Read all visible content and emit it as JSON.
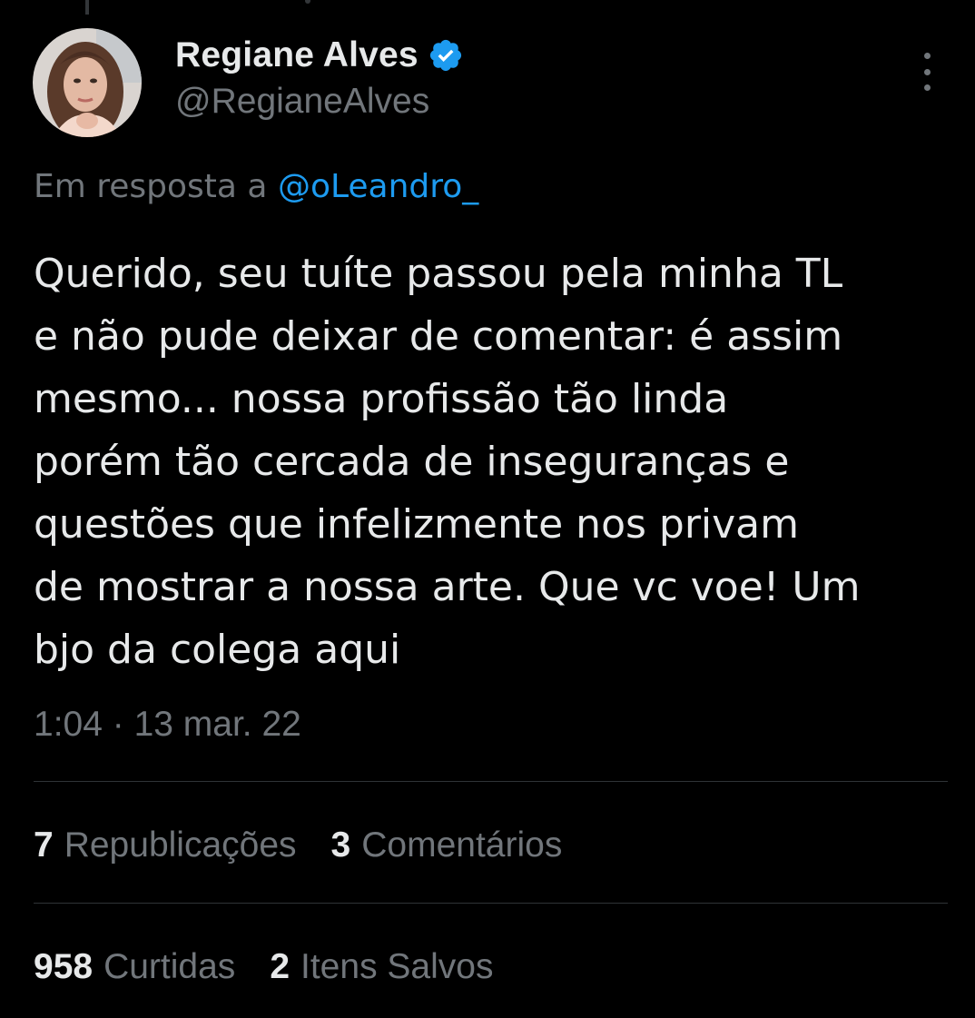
{
  "author": {
    "name": "Regiane Alves",
    "handle": "@RegianeAlves",
    "verified": true,
    "verified_color": "#1d9bf0"
  },
  "reply": {
    "prefix": "Em resposta a",
    "to": "@oLeandro_"
  },
  "tweet": {
    "text": "Querido, seu tuíte passou pela minha TL\ne não pude deixar de comentar: é assim\nmesmo... nossa profissão tão linda\nporém tão cercada de inseguranças e\nquestões que infelizmente nos privam\nde mostrar a nossa arte. Que vc voe! Um\nbjo da colega aqui",
    "timestamp": "1:04 · 13 mar. 22"
  },
  "stats": {
    "reposts": {
      "count": "7",
      "label": "Republicações"
    },
    "comments": {
      "count": "3",
      "label": "Comentários"
    },
    "likes": {
      "count": "958",
      "label": "Curtidas"
    },
    "saves": {
      "count": "2",
      "label": "Itens Salvos"
    }
  },
  "icons": {
    "more": "more-vertical-icon",
    "verified": "verified-badge-icon"
  },
  "colors": {
    "background": "#000000",
    "text": "#e7e9ea",
    "secondary": "#71767b",
    "link": "#1d9bf0",
    "divider": "#2f3336"
  }
}
